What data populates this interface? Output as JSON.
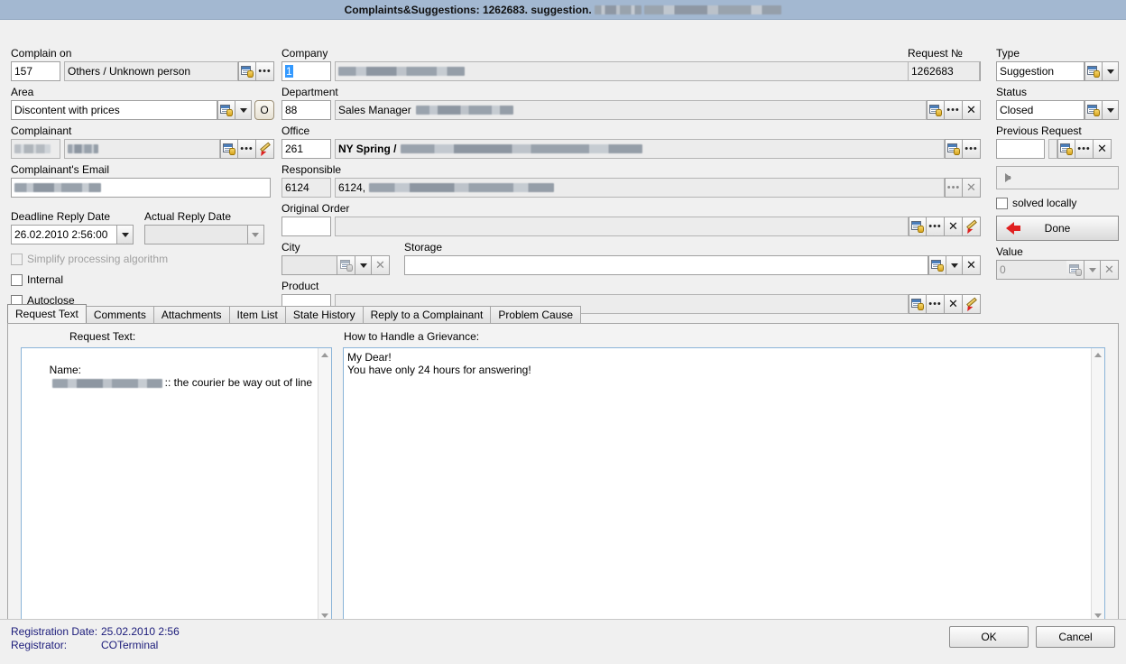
{
  "window": {
    "title_prefix": "Complaints&Suggestions:",
    "request_no": "1262683.",
    "type_word": "suggestion."
  },
  "left": {
    "complain_on_label": "Complain on",
    "complain_on_code": "157",
    "complain_on_name": "Others / Unknown person",
    "area_label": "Area",
    "area_value": "Discontent with prices",
    "area_extra_button": "O",
    "complainant_label": "Complainant",
    "complainant_email_label": "Complainant's Email",
    "deadline_label": "Deadline Reply Date",
    "deadline_value": "26.02.2010 2:56:00",
    "actual_label": "Actual Reply Date",
    "actual_value": "",
    "simplify_label": "Simplify processing algorithm",
    "internal_label": "Internal",
    "autoclose_label": "Autoclose"
  },
  "middle": {
    "company_label": "Company",
    "company_code": "1",
    "department_label": "Department",
    "department_code": "88",
    "department_name": "Sales Manager",
    "office_label": "Office",
    "office_code": "261",
    "office_name": "NY Spring /",
    "responsible_label": "Responsible",
    "responsible_code": "6124",
    "responsible_name": "6124,",
    "original_order_label": "Original Order",
    "original_order_code": "",
    "city_label": "City",
    "city_value": "",
    "storage_label": "Storage",
    "storage_value": "",
    "product_label": "Product",
    "product_code": ""
  },
  "right": {
    "request_no_label": "Request №",
    "request_no_value": "1262683",
    "type_label": "Type",
    "type_value": "Suggestion",
    "status_label": "Status",
    "status_value": "Closed",
    "previous_request_label": "Previous Request",
    "previous_request_code": "",
    "previous_request_name": "",
    "solved_locally_label": "solved locally",
    "done_label": "Done",
    "value_label": "Value",
    "value_value": "0"
  },
  "tabs": [
    {
      "label": "Request Text",
      "active": true
    },
    {
      "label": "Comments",
      "active": false
    },
    {
      "label": "Attachments",
      "active": false
    },
    {
      "label": "Item List",
      "active": false
    },
    {
      "label": "State History",
      "active": false
    },
    {
      "label": "Reply to a Complainant",
      "active": false
    },
    {
      "label": "Problem Cause",
      "active": false
    }
  ],
  "tab_content": {
    "request_text_label": "Request Text:",
    "request_text_prefix": "Name:",
    "request_text_suffix": ":: the courier be way out of line",
    "grievance_label": "How to Handle a Grievance:",
    "grievance_text": "My Dear!\nYou have only 24 hours for answering!"
  },
  "footer": {
    "registration_date_label": "Registration Date:",
    "registration_date_value": "25.02.2010 2:56",
    "registrator_label": "Registrator:",
    "registrator_value": "COTerminal",
    "ok_label": "OK",
    "cancel_label": "Cancel"
  },
  "colors": {
    "titlebar": "#a3b8d1",
    "accent_blue": "#3399ff",
    "done_arrow": "#e02020",
    "footer_text": "#1b1b7a"
  }
}
